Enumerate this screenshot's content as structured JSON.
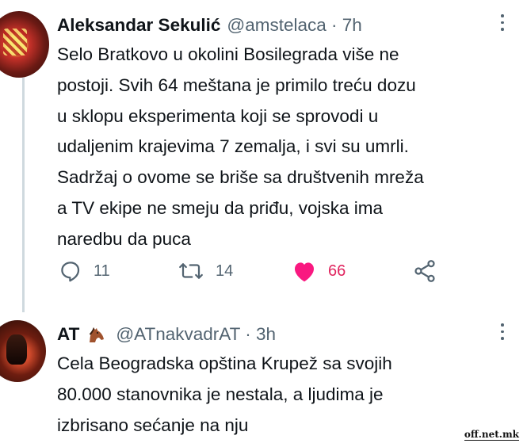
{
  "tweets": [
    {
      "author_name": "Aleksandar Sekulić",
      "handle": "@amstelaca · 7h",
      "text": "Selo Bratkovo u okolini Bosilegrada više ne postoji. Svih 64 meštana je primilo treću dozu u sklopu eksperimenta koji se sprovodi u udaljenim krajevima 7 zemalja, i svi su umrli. Sadržaj o ovome se briše sa društvenih mreža a TV ekipe ne smeju da priđu, vojska ima naredbu da puca",
      "lines": [
        "Selo Bratkovo u okolini Bosilegrada više ne",
        "postoji. Svih 64 meštana je primilo treću dozu",
        "u sklopu eksperimenta koji se sprovodi u",
        "udaljenim krajevima 7 zemalja, i svi su umrli.",
        "Sadržaj o ovome se briše sa društvenih mreža",
        "a TV ekipe ne smeju da priđu, vojska ima",
        "naredbu da puca"
      ],
      "replies": "11",
      "retweets": "14",
      "likes": "66",
      "liked": true
    },
    {
      "author_name": "AT",
      "author_emoji": "horse-face-icon",
      "handle": "@ATnakvadrAT · 3h",
      "lines": [
        "Cela Beogradska opština Krupež sa svojih",
        "80.000 stanovnika je nestala, a ljudima je",
        "izbrisano sećanje na nju"
      ]
    }
  ],
  "watermark": "off.net.mk",
  "colors": {
    "text": "#0f1419",
    "muted": "#536471",
    "like": "#e0245e",
    "thread_line": "#cfd9de"
  }
}
